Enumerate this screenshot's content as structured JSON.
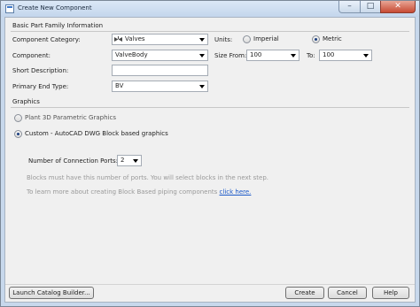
{
  "window": {
    "title": "Create New Component",
    "minimize_glyph": "–",
    "maximize_glyph": "□",
    "close_glyph": "✕"
  },
  "basic_info": {
    "header": "Basic Part Family Information",
    "category_label": "Component Category:",
    "category_value": "Valves",
    "category_icon": "valve-icon",
    "component_label": "Component:",
    "component_value": "ValveBody",
    "short_desc_label": "Short Description:",
    "short_desc_value": "",
    "end_type_label": "Primary End Type:",
    "end_type_value": "BV",
    "units_label": "Units:",
    "units_imperial": "Imperial",
    "units_metric": "Metric",
    "units_selected": "Metric",
    "size_from_label": "Size From:",
    "size_from_value": "100",
    "to_label": "To:",
    "to_value": "100"
  },
  "graphics": {
    "header": "Graphics",
    "option_parametric": "Plant 3D Parametric Graphics",
    "option_custom": "Custom - AutoCAD DWG Block based graphics",
    "selected": "custom",
    "ports_label": "Number of Connection Ports:",
    "ports_value": "2",
    "hint_blocks": "Blocks must have this number of ports. You will select blocks in the next step.",
    "hint_learn": "To learn more about creating Block Based piping components ",
    "link_text": "click here."
  },
  "footer": {
    "launch_label": "Launch Catalog Builder...",
    "create_label": "Create",
    "cancel_label": "Cancel",
    "help_label": "Help"
  },
  "colors": {
    "title_bar": "#c7d8ec",
    "close_button": "#c74a33",
    "link": "#1a58c8",
    "hint_text": "#999999"
  }
}
